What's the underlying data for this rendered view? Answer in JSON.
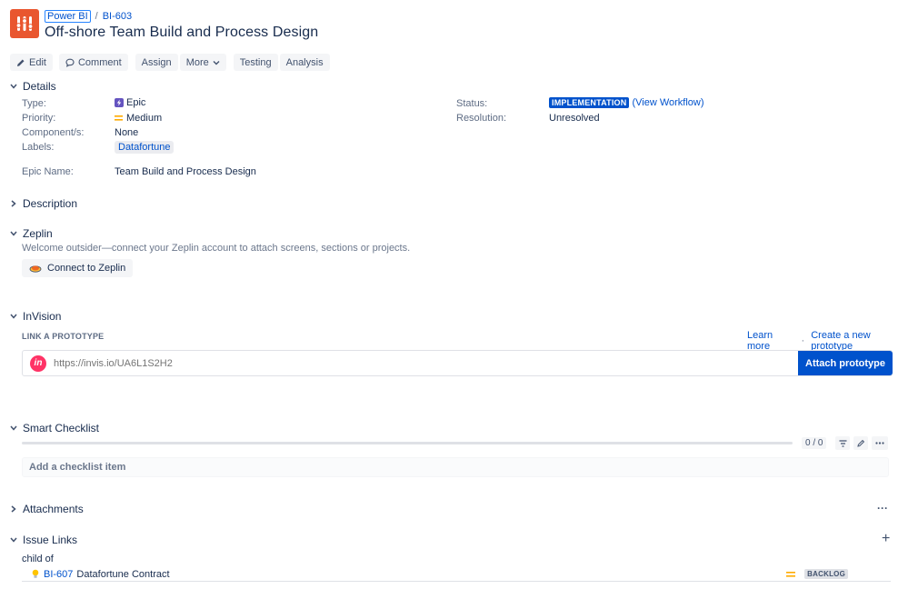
{
  "breadcrumb": {
    "project": "Power BI",
    "separator": "/",
    "issue_key": "BI-603"
  },
  "issue": {
    "title": "Off-shore Team Build and Process Design"
  },
  "toolbar": {
    "edit": "Edit",
    "comment": "Comment",
    "assign": "Assign",
    "more": "More",
    "testing": "Testing",
    "analysis": "Analysis"
  },
  "details": {
    "heading": "Details",
    "type_label": "Type:",
    "type_value": "Epic",
    "priority_label": "Priority:",
    "priority_value": "Medium",
    "components_label": "Component/s:",
    "components_value": "None",
    "labels_label": "Labels:",
    "labels_value": "Datafortune",
    "epic_name_label": "Epic Name:",
    "epic_name_value": "Team Build and Process Design",
    "status_label": "Status:",
    "status_value": "IMPLEMENTATION",
    "view_workflow": "(View Workflow)",
    "resolution_label": "Resolution:",
    "resolution_value": "Unresolved"
  },
  "description": {
    "heading": "Description"
  },
  "zeplin": {
    "heading": "Zeplin",
    "message": "Welcome outsider—connect your Zeplin account to attach screens, sections or projects.",
    "button": "Connect to Zeplin"
  },
  "invision": {
    "heading": "InVision",
    "sub_heading": "LINK A PROTOTYPE",
    "learn_more": "Learn more",
    "dot": "·",
    "create_new": "Create a new prototype",
    "logo_text": "in",
    "placeholder": "https://invis.io/UA6L1S2H2",
    "attach_button": "Attach prototype"
  },
  "checklist": {
    "heading": "Smart Checklist",
    "count": "0 / 0",
    "add_placeholder": "Add a checklist item",
    "progress": 0
  },
  "attachments": {
    "heading": "Attachments",
    "more": "···"
  },
  "issue_links": {
    "heading": "Issue Links",
    "add": "+",
    "relation": "child of",
    "items": [
      {
        "key": "BI-607",
        "summary": "Datafortune Contract",
        "status": "BACKLOG"
      }
    ]
  },
  "colors": {
    "accent": "#0052cc",
    "project_avatar": "#e9562f",
    "epic": "#6554c0",
    "medium_priority": "#ffab00",
    "invision": "#ff3366"
  }
}
